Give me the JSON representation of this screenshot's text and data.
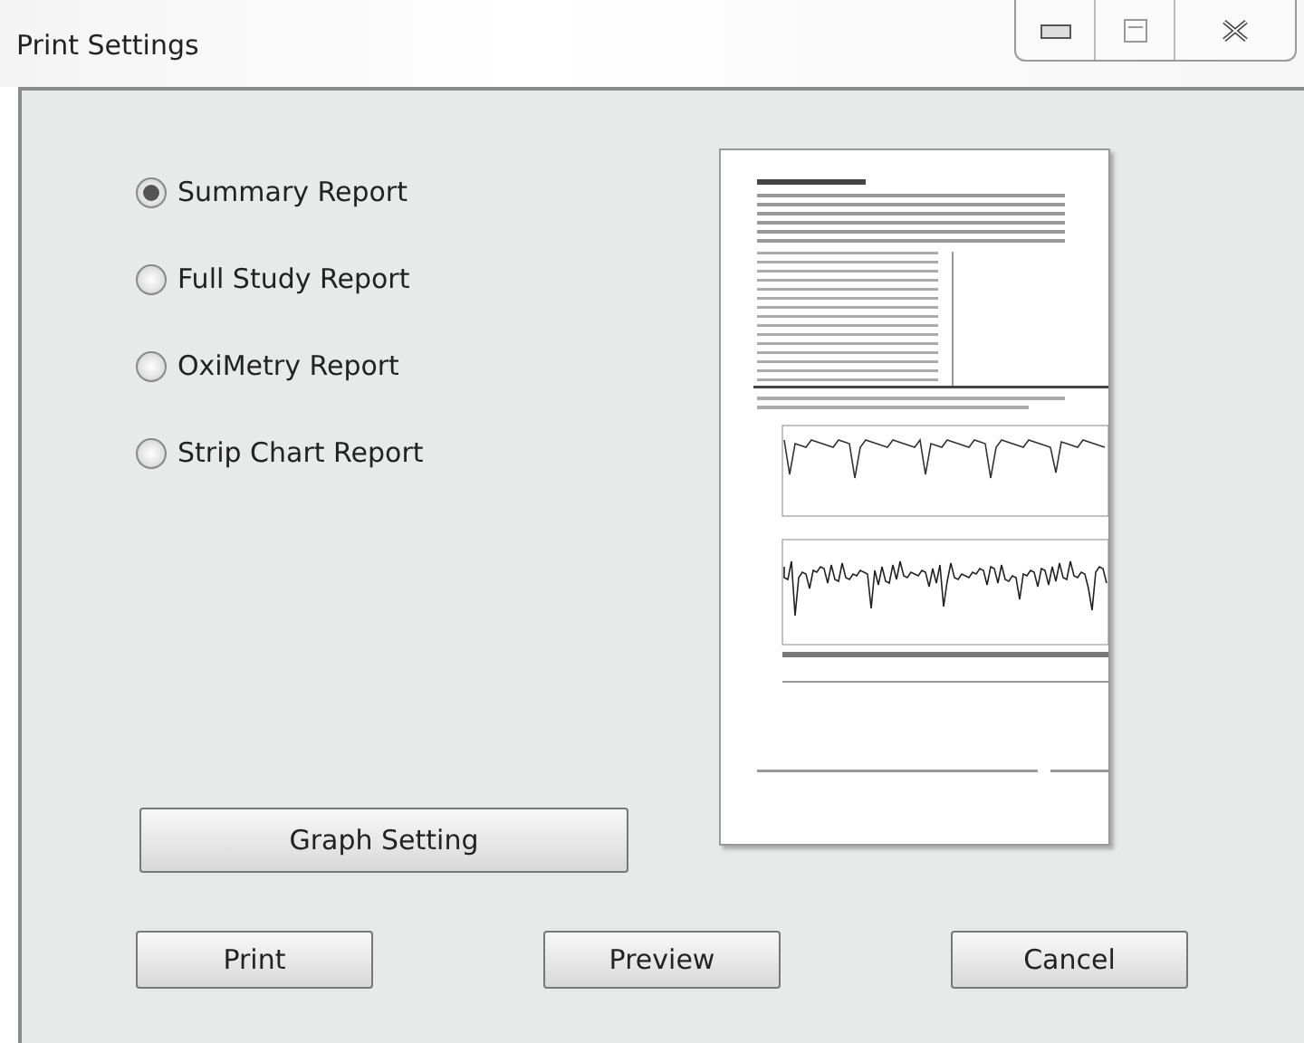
{
  "window": {
    "title": "Print Settings"
  },
  "report_types": [
    {
      "label": "Summary Report",
      "selected": true
    },
    {
      "label": "Full Study Report",
      "selected": false
    },
    {
      "label": "OxiMetry Report",
      "selected": false
    },
    {
      "label": "Strip Chart Report",
      "selected": false
    }
  ],
  "graph_setting_button": "Graph Setting",
  "preview": {
    "kind": "picture"
  },
  "buttons": [
    "Print",
    "Preview",
    "Cancel"
  ]
}
